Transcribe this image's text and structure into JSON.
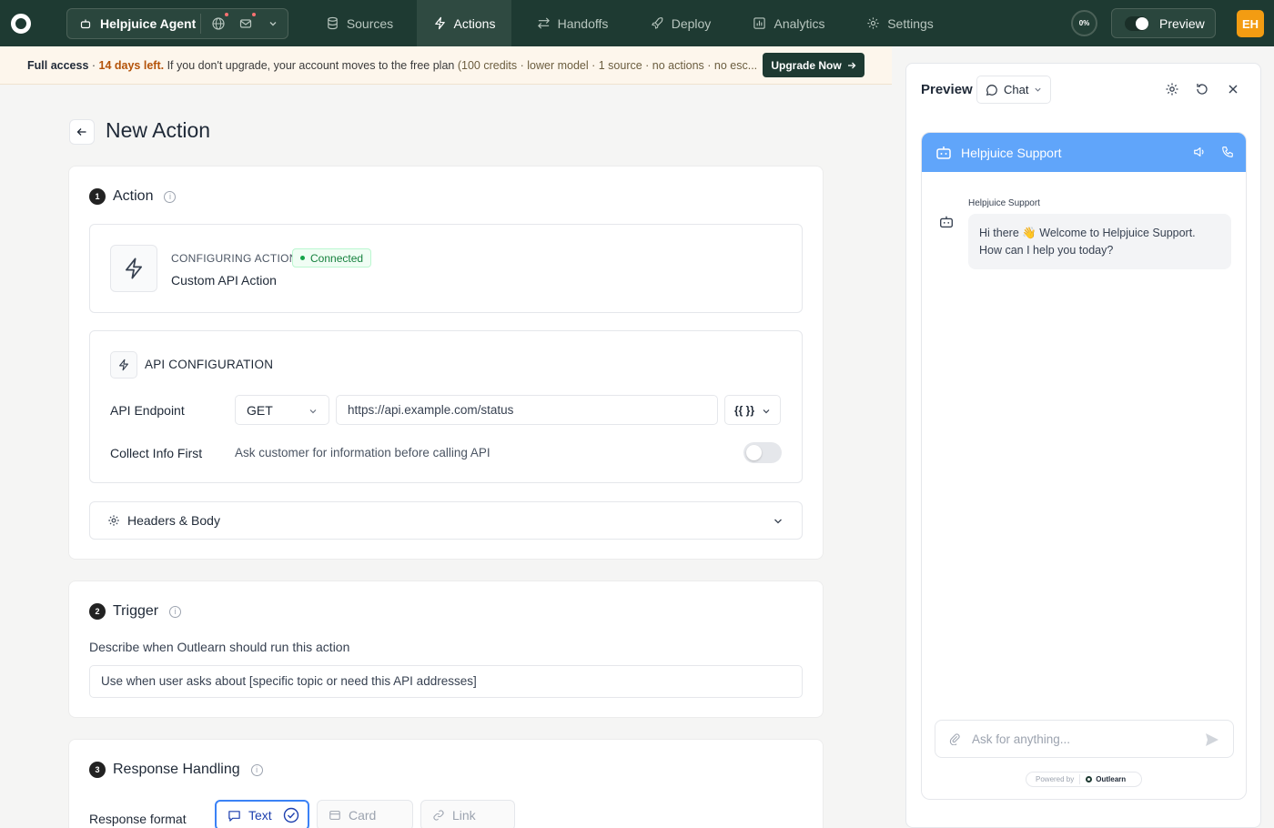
{
  "nav": {
    "agent_name": "Helpjuice Agent",
    "items": [
      {
        "label": "Sources",
        "icon": "database-icon"
      },
      {
        "label": "Actions",
        "icon": "bolt-icon",
        "active": true
      },
      {
        "label": "Handoffs",
        "icon": "arrows-icon"
      },
      {
        "label": "Deploy",
        "icon": "rocket-icon"
      },
      {
        "label": "Analytics",
        "icon": "chart-icon"
      },
      {
        "label": "Settings",
        "icon": "gear-icon"
      }
    ],
    "progress": "0%",
    "preview_label": "Preview",
    "avatar_initials": "EH"
  },
  "banner": {
    "access": "Full access",
    "days": "14 days left.",
    "message": "If you don't upgrade, your account moves to the free plan",
    "details": "(100 credits · lower model · 1 source · no actions · no esc...",
    "upgrade_label": "Upgrade Now"
  },
  "page": {
    "title": "New Action"
  },
  "action_section": {
    "step": "1",
    "title": "Action",
    "config_label": "CONFIGURING ACTION",
    "status": "Connected",
    "action_name": "Custom API Action",
    "api_title": "API CONFIGURATION",
    "endpoint_label": "API Endpoint",
    "method": "GET",
    "url": "https://api.example.com/status",
    "var_label": "{{ }}",
    "collect_label": "Collect Info First",
    "collect_desc": "Ask customer for information before calling API",
    "collect_enabled": false,
    "headers_label": "Headers & Body"
  },
  "trigger_section": {
    "step": "2",
    "title": "Trigger",
    "description": "Describe when Outlearn should run this action",
    "value": "Use when user asks about [specific topic or need this API addresses]"
  },
  "response_section": {
    "step": "3",
    "title": "Response Handling",
    "format_label": "Response format",
    "formats": [
      {
        "label": "Text",
        "selected": true
      },
      {
        "label": "Card",
        "selected": false
      },
      {
        "label": "Link",
        "selected": false
      }
    ]
  },
  "preview": {
    "title": "Preview",
    "mode": "Chat",
    "chat_title": "Helpjuice Support",
    "sender": "Helpjuice Support",
    "message": "Hi there 👋 Welcome to Helpjuice Support. How can I help you today?",
    "input_placeholder": "Ask for anything...",
    "powered_by": "Powered by",
    "brand": "Outlearn"
  },
  "colors": {
    "nav_bg": "#1e3a32",
    "accent": "#3b82f6",
    "chat_header": "#60a5fa",
    "avatar": "#f39c12"
  }
}
